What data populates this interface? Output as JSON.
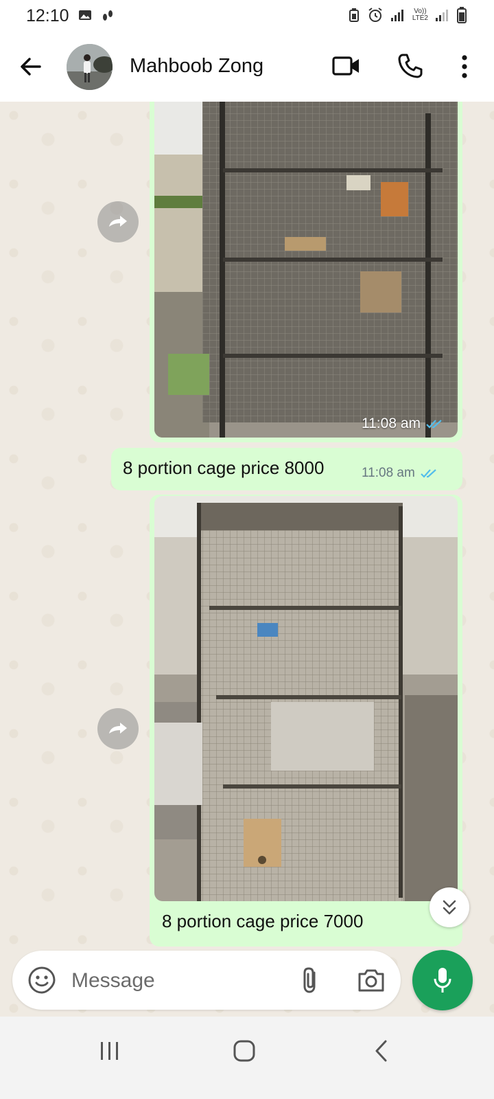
{
  "status_bar": {
    "time": "12:10",
    "network_label_top": "Vo))",
    "network_label_bottom": "LTE2"
  },
  "header": {
    "contact_name": "Mahboob Zong",
    "icons": [
      "back-arrow-icon",
      "video-call-icon",
      "phone-icon",
      "more-vert-icon"
    ]
  },
  "messages": [
    {
      "type": "image",
      "image_desc": "photo of wire bird cages",
      "time": "11:08 am",
      "status": "read"
    },
    {
      "type": "text",
      "text": "8 portion cage price 8000",
      "time": "11:08 am",
      "status": "read"
    },
    {
      "type": "image",
      "image_desc": "photo of tall multi-portion metal cage",
      "caption": "8 portion cage price 7000"
    }
  ],
  "composer": {
    "placeholder": "Message"
  },
  "colors": {
    "outgoing_bubble": "#d9fdd3",
    "chat_bg": "#efeae2",
    "mic_button": "#1aa05a",
    "read_ticks": "#53bdeb"
  }
}
